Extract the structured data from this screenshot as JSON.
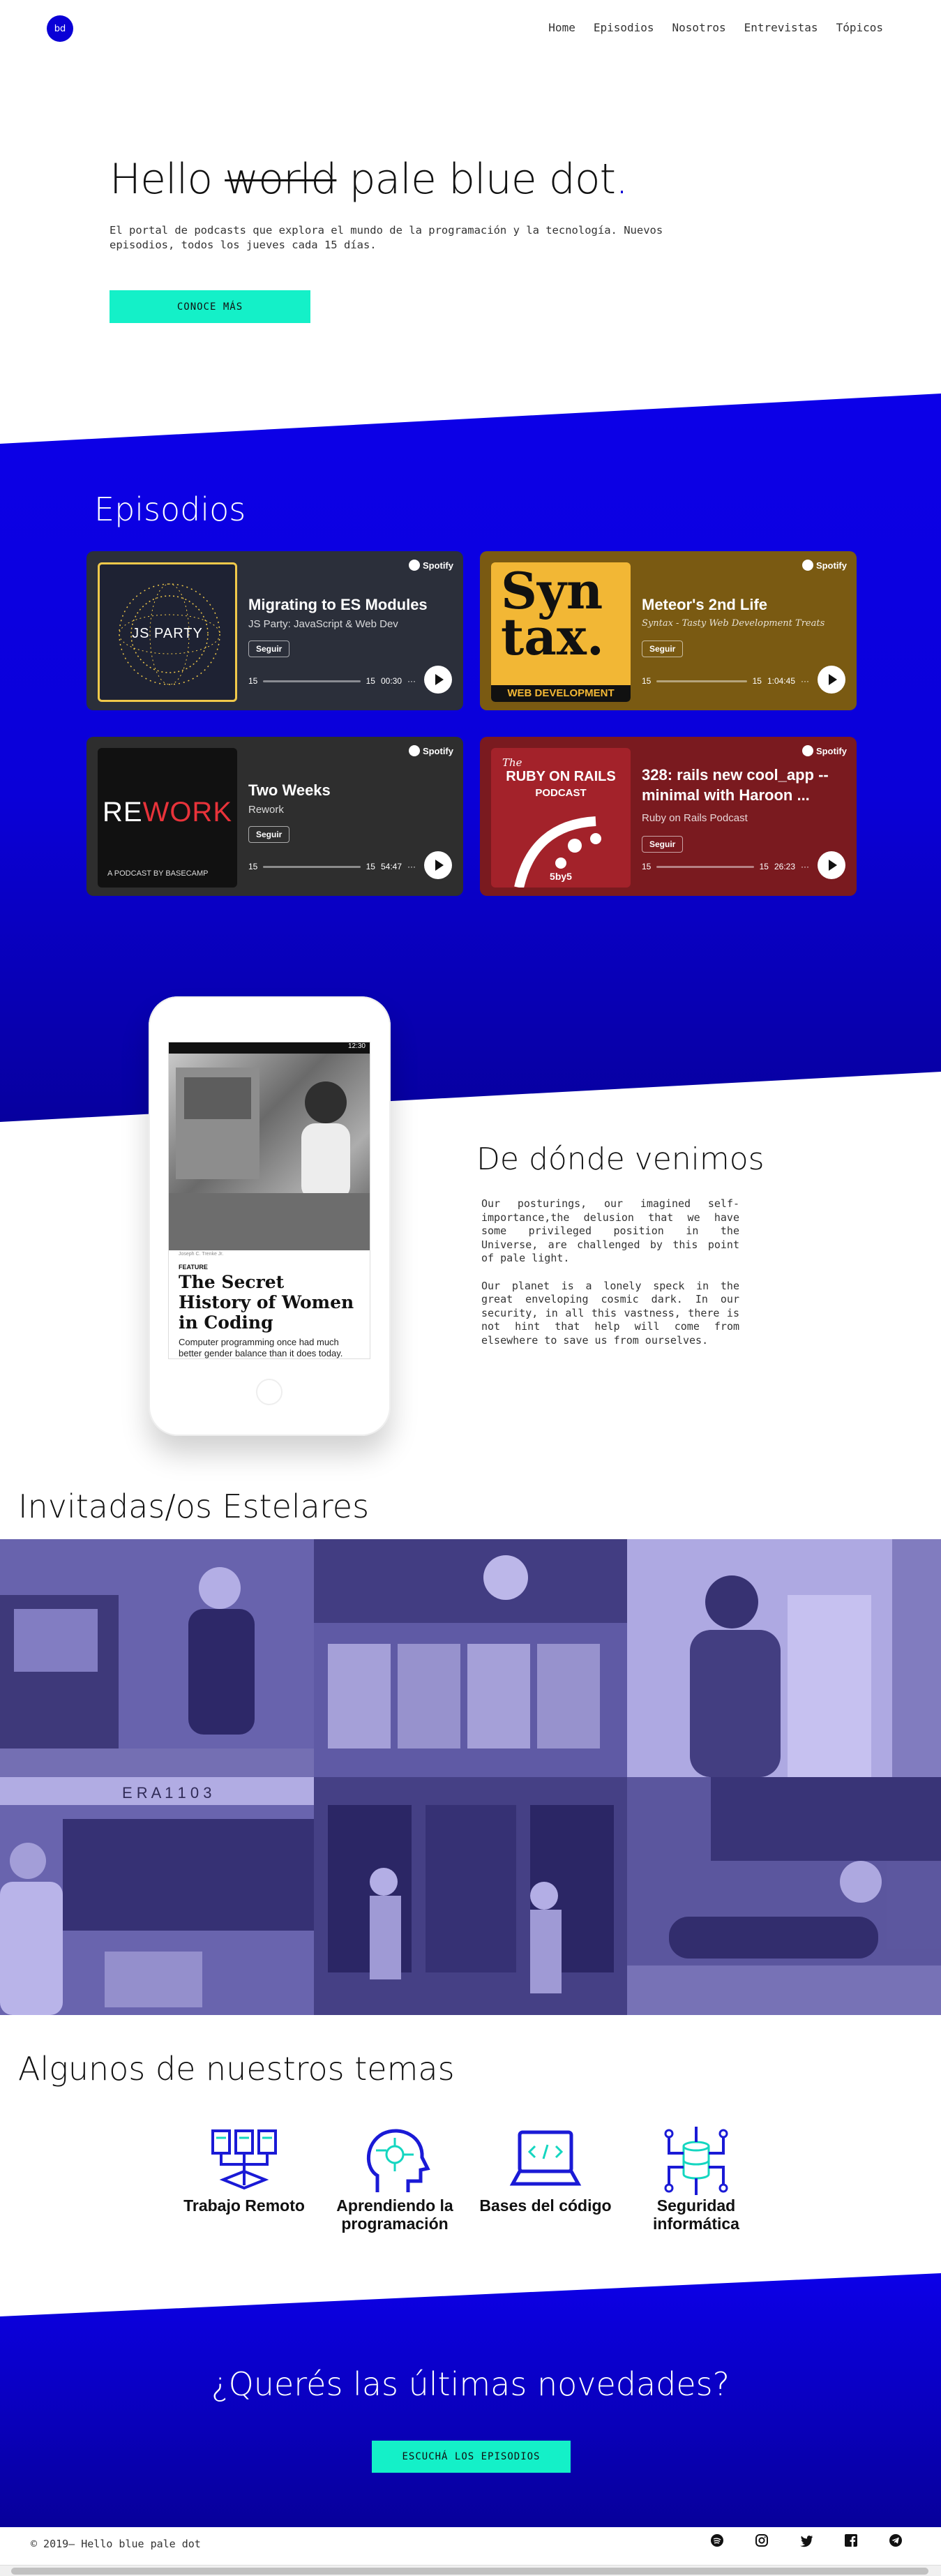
{
  "nav": {
    "logo": "bd",
    "links": [
      "Home",
      "Episodios",
      "Nosotros",
      "Entrevistas",
      "Tópicos"
    ]
  },
  "hero": {
    "title_pre": "Hello ",
    "title_strike": "world",
    "title_post": " pale blue dot",
    "title_dot": ".",
    "subtitle": "El portal de podcasts que explora el mundo de la programación y la tecnología. Nuevos episodios, todos los jueves cada 15 días.",
    "button": "CONOCE MÁS"
  },
  "episodes": {
    "title": "Episodios",
    "cards": [
      {
        "name": "Migrating to ES Modules",
        "show": "JS Party: JavaScript & Web Dev",
        "follow": "Seguir",
        "brand": "Spotify",
        "skip_back": "15",
        "skip_fwd": "15",
        "duration": "00:30",
        "art_text": "JS PARTY",
        "bg": "#2b2f3a"
      },
      {
        "name": "Meteor's 2nd Life",
        "show": "Syntax - Tasty Web Development Treats",
        "follow": "Seguir",
        "brand": "Spotify",
        "skip_back": "15",
        "skip_fwd": "15",
        "duration": "1:04:45",
        "art_text_1": "Syn",
        "art_text_2": "tax.",
        "art_text_3": "WEB DEVELOPMENT",
        "bg": "#7a5a12"
      },
      {
        "name": "Two Weeks",
        "show": "Rework",
        "follow": "Seguir",
        "brand": "Spotify",
        "skip_back": "15",
        "skip_fwd": "15",
        "duration": "54:47",
        "art_text_1": "RE",
        "art_text_2": "WORK",
        "art_text_3": "A PODCAST BY BASECAMP",
        "bg": "#2e2e2e"
      },
      {
        "name": "328: rails new cool_app --minimal with Haroon ...",
        "show": "Ruby on Rails Podcast",
        "follow": "Seguir",
        "brand": "Spotify",
        "skip_back": "15",
        "skip_fwd": "15",
        "duration": "26:23",
        "art_text_1": "The",
        "art_text_2": "RUBY ON RAILS",
        "art_text_3": "PODCAST",
        "art_text_4": "5by5",
        "bg": "#7a1a1f"
      }
    ]
  },
  "origin": {
    "title": "De dónde venimos",
    "paragraphs": [
      "Our posturings, our imagined self-importance,the delusion that we have some privileged position in the Universe, are challenged by this point of pale light.",
      "Our planet is a lonely speck in the great enveloping cosmic dark. In our security, in all this vastness, there is not hint that help will come from elsewhere to save us from ourselves."
    ],
    "phone": {
      "time": "12:30",
      "caption": "Joseph C. Trenke Jr.",
      "tag": "FEATURE",
      "headline": "The Secret History of Women in Coding",
      "body": "Computer programming once had much better gender balance than it does today. What went wrong?"
    }
  },
  "guests": {
    "title": "Invitadas/os Estelares",
    "photo_text": "E R A   1 1 0 3"
  },
  "topics": {
    "title": "Algunos de nuestros temas",
    "items": [
      {
        "label": "Trabajo Remoto",
        "icon": "remote-work-icon"
      },
      {
        "label": "Aprendiendo la programación",
        "icon": "learning-programming-icon"
      },
      {
        "label": "Bases del código",
        "icon": "code-basics-icon"
      },
      {
        "label": "Seguridad informática",
        "icon": "security-icon"
      }
    ]
  },
  "cta": {
    "title": "¿Querés las últimas novedades?",
    "button": "ESCUCHÁ LOS EPISODIOS"
  },
  "footer": {
    "copyright": "© 2019— Hello blue pale dot",
    "socials": [
      "spotify-icon",
      "instagram-icon",
      "twitter-icon",
      "facebook-icon",
      "telegram-icon"
    ]
  },
  "colors": {
    "brand": "#0a00d6",
    "accent": "#14f0c8"
  }
}
